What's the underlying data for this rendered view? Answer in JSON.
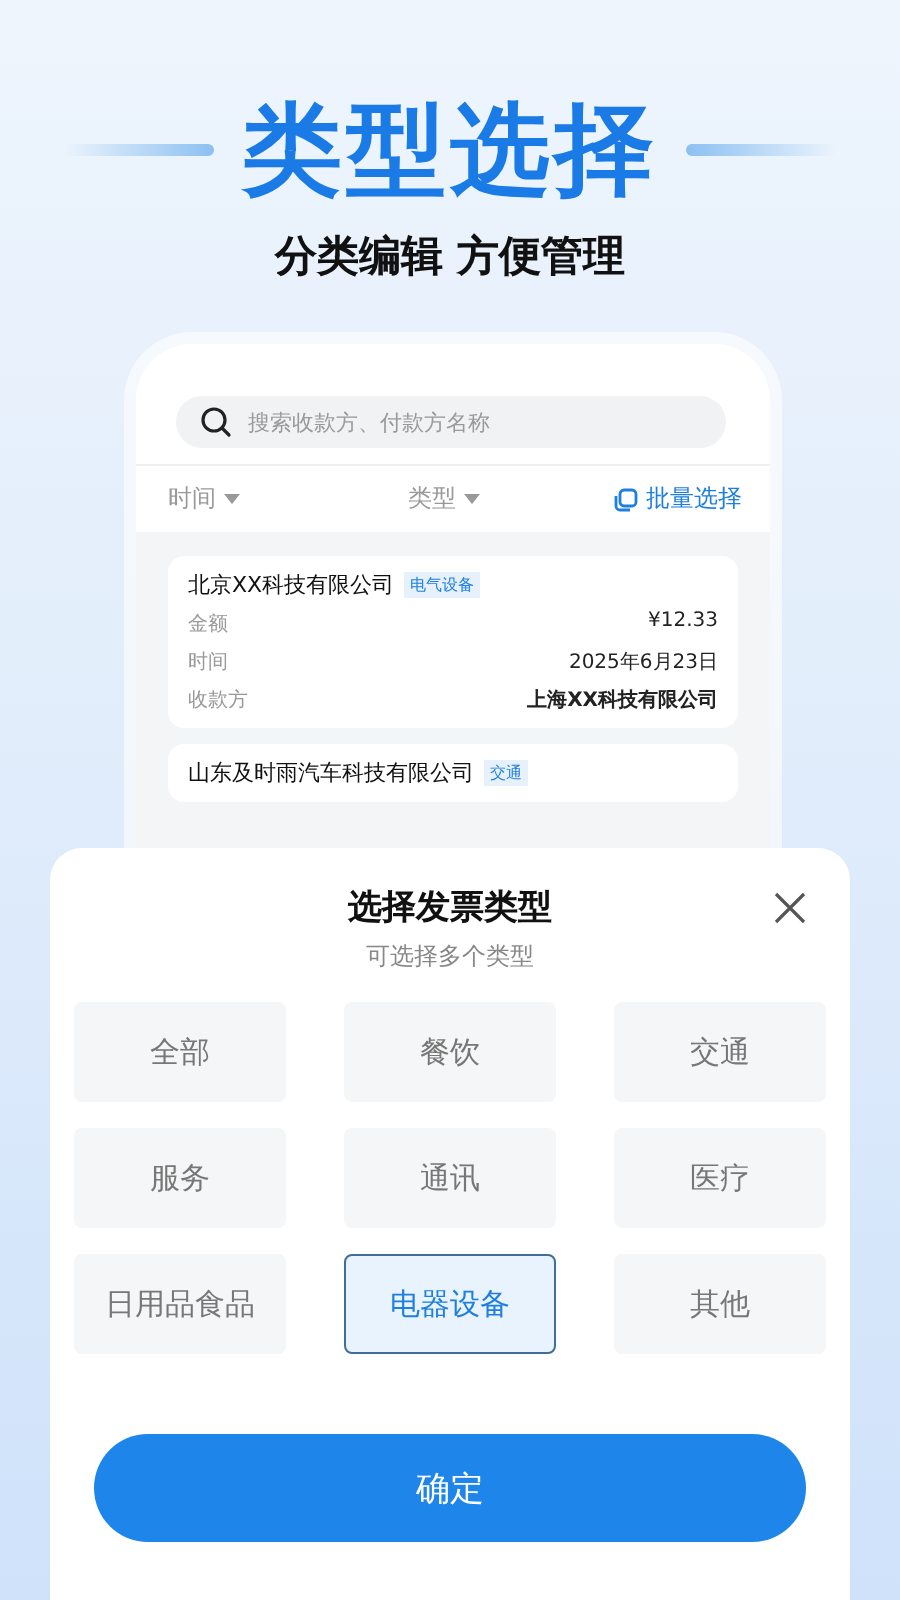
{
  "headline": "类型选择",
  "subtitle": "分类编辑 方便管理",
  "search": {
    "placeholder": "搜索收款方、付款方名称"
  },
  "filters": [
    {
      "label": "时间"
    },
    {
      "label": "类型"
    }
  ],
  "batch_select": "批量选择",
  "invoices": [
    {
      "company": "北京XX科技有限公司",
      "tag": "电气设备",
      "fields": [
        {
          "label": "金额",
          "value": "¥12.33"
        },
        {
          "label": "时间",
          "value": "2025年6月23日"
        },
        {
          "label": "收款方",
          "value": "上海XX科技有限公司"
        }
      ]
    },
    {
      "company": "山东及时雨汽车科技有限公司",
      "tag": "交通"
    }
  ],
  "sheet": {
    "title": "选择发票类型",
    "hint": "可选择多个类型",
    "options": [
      {
        "label": "全部",
        "selected": false
      },
      {
        "label": "餐饮",
        "selected": false
      },
      {
        "label": "交通",
        "selected": false
      },
      {
        "label": "服务",
        "selected": false
      },
      {
        "label": "通讯",
        "selected": false
      },
      {
        "label": "医疗",
        "selected": false
      },
      {
        "label": "日用品食品",
        "selected": false
      },
      {
        "label": "电器设备",
        "selected": true
      },
      {
        "label": "其他",
        "selected": false
      }
    ],
    "confirm": "确定"
  }
}
